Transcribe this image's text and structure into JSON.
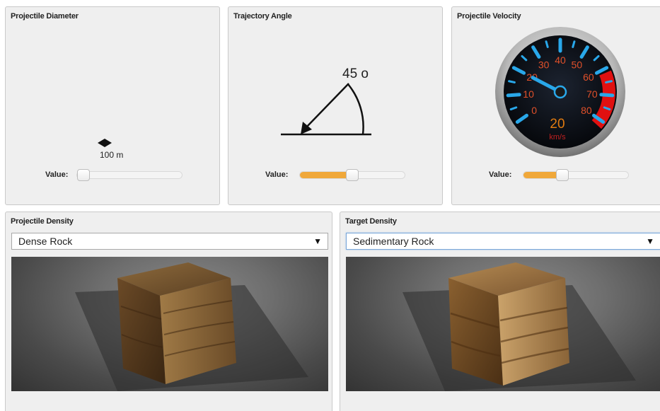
{
  "diameter": {
    "title": "Projectile Diameter",
    "value_label": "Value:",
    "size_text": "100 m",
    "slider_fraction": 0.0
  },
  "angle": {
    "title": "Trajectory Angle",
    "angle_text": "45 o",
    "value_label": "Value:",
    "slider_fraction": 0.5
  },
  "velocity": {
    "title": "Projectile Velocity",
    "gauge_ticks": [
      "0",
      "10",
      "20",
      "30",
      "40",
      "50",
      "60",
      "70",
      "80"
    ],
    "readout": "20",
    "unit": "km/s",
    "value_label": "Value:",
    "slider_fraction": 0.35,
    "colors": {
      "tick": "#29a8ea",
      "number": "#e0502a",
      "redzone": "#e01010",
      "readout": "#e07a10"
    }
  },
  "projectile_density": {
    "title": "Projectile Density",
    "selected": "Dense Rock",
    "arrow": "▼",
    "image_icon": "rock-cube-image"
  },
  "target_density": {
    "title": "Target Density",
    "selected": "Sedimentary Rock",
    "arrow": "▼",
    "image_icon": "rock-cube-image"
  },
  "colors": {
    "slider_fill": "#f0a83a",
    "panel_bg": "#efefef"
  }
}
